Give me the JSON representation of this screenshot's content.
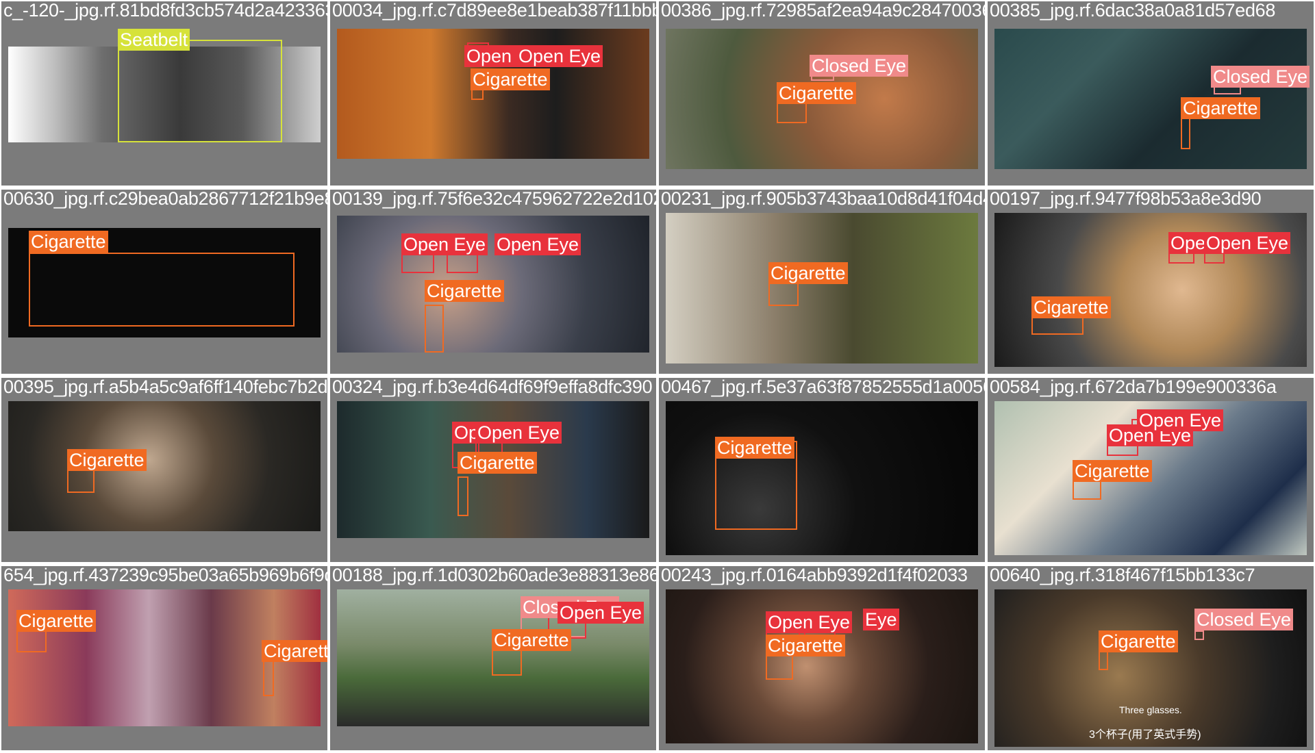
{
  "colors": {
    "Cigarette": "#f06a22",
    "Open Eye": "#e8323c",
    "Closed Eye": "#f08a8a",
    "Seatbelt": "#d6e23a",
    "tile_bg": "#7b7b7b"
  },
  "tiles": [
    {
      "filename": "c_-120-_jpg.rf.81bd8fd3cb574d2a4233634ab",
      "labels": [
        "Seatbelt"
      ]
    },
    {
      "filename": "00034_jpg.rf.c7d89ee8e1beab387f11bbb",
      "labels": [
        "Open Eye",
        "Open Eye",
        "Cigarette"
      ]
    },
    {
      "filename": "00386_jpg.rf.72985af2ea94a9c284700365_59",
      "labels": [
        "Closed Eye",
        "Cigarette"
      ]
    },
    {
      "filename": "00385_jpg.rf.6dac38a0a81d57ed68",
      "labels": [
        "Closed Eye",
        "Cigarette"
      ]
    },
    {
      "filename": "00630_jpg.rf.c29bea0ab2867712f21b9e840",
      "labels": [
        "Cigarette"
      ]
    },
    {
      "filename": "00139_jpg.rf.75f6e32c475962722e2d102d",
      "labels": [
        "Open Eye",
        "Open Eye",
        "Cigarette"
      ]
    },
    {
      "filename": "00231_jpg.rf.905b3743baa10d8d41f04d43_3",
      "labels": [
        "Cigarette"
      ]
    },
    {
      "filename": "00197_jpg.rf.9477f98b53a8e3d90",
      "labels": [
        "Open Eye",
        "Open Eye",
        "Cigarette"
      ]
    },
    {
      "filename": "00395_jpg.rf.a5b4a5c9af6ff140febc7b2d",
      "labels": [
        "Cigarette"
      ]
    },
    {
      "filename": "00324_jpg.rf.b3e4d64df69f9effa8dfc390",
      "labels": [
        "Open Eye",
        "Open Eye",
        "Cigarette"
      ]
    },
    {
      "filename": "00467_jpg.rf.5e37a63f87852555d1a00566",
      "labels": [
        "Cigarette"
      ]
    },
    {
      "filename": "00584_jpg.rf.672da7b199e900336a",
      "labels": [
        "Open Eye",
        "Open Eye",
        "Cigarette"
      ]
    },
    {
      "filename": "654_jpg.rf.437239c95be03a65b969b6f9d183",
      "labels": [
        "Cigarette",
        "Cigarette"
      ]
    },
    {
      "filename": "00188_jpg.rf.1d0302b60ade3e88313e8659",
      "labels": [
        "Closed Eye",
        "Open Eye",
        "Cigarette"
      ]
    },
    {
      "filename": "00243_jpg.rf.0164abb9392d1f4f02033",
      "labels": [
        "Open Eye",
        "Eye",
        "Cigarette"
      ]
    },
    {
      "filename": "00640_jpg.rf.318f467f15bb133c7",
      "labels": [
        "Closed Eye",
        "Cigarette"
      ]
    }
  ],
  "subtitles": {
    "english": "Three glasses.",
    "chinese": "3个杯子(用了英式手势)"
  }
}
